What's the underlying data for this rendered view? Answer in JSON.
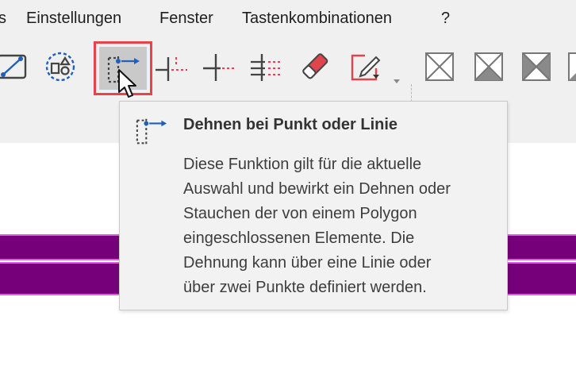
{
  "menubar": {
    "items": [
      "s",
      "Einstellungen",
      "Fenster",
      "Tastenkombinationen",
      "?"
    ]
  },
  "toolbar": {
    "icons": [
      "edit-line-icon",
      "shape-group-icon",
      "stretch-point-line-icon",
      "line-end-dashed-icon",
      "line-cross-dashed-icon",
      "multi-line-dashed-icon",
      "eraser-icon",
      "edit-shape-dropdown-icon",
      "box-cross-icon",
      "box-cross-bottom-filled-icon",
      "box-cross-left-filled-icon",
      "box-cross-partial-icon"
    ],
    "active_button": "stretch-point-line-button",
    "active_highlight_color": "#e8424a",
    "accent_blue": "#1f5fbf",
    "accent_red": "#e0454d"
  },
  "tooltip": {
    "icon": "stretch-point-line-icon",
    "title": "Dehnen bei Punkt oder Linie",
    "body": "Diese Funktion gilt für die aktuelle\nAuswahl und bewirkt ein Dehnen oder\nStauchen der von einem Polygon\neingeschlossenen Elemente. Die\nDehnung kann über eine Linie oder\nüber zwei Punkte definiert werden."
  },
  "canvas": {
    "band_color": "#76007a",
    "band_border_color": "#e05be5"
  }
}
